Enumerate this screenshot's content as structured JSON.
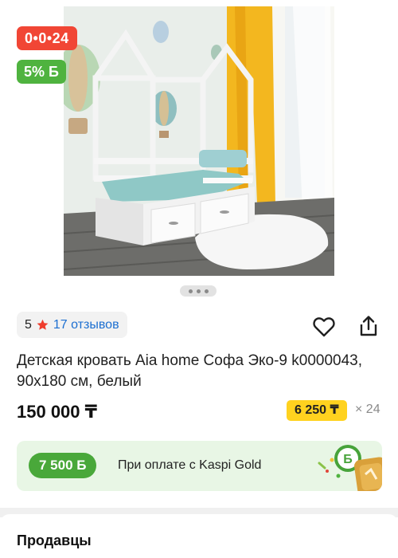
{
  "gallery": {
    "installment_badge": "0•0•24",
    "bonus_badge": "5% Б",
    "pager_count": 3
  },
  "rating": {
    "score": "5",
    "reviews": "17 отзывов"
  },
  "product": {
    "title": "Детская кровать Aia home Софа Эко-9 k0000043, 90х180 см, белый",
    "price": "150 000 ₸",
    "monthly": "6 250 ₸",
    "months": "× 24"
  },
  "kaspi_gold": {
    "bonus": "7 500 Б",
    "text": "При оплате с Kaspi Gold"
  },
  "sellers": {
    "title": "Продавцы"
  },
  "colors": {
    "installment_red": "#f14635",
    "bonus_green": "#4fb33f",
    "monthly_yellow": "#ffd21f",
    "link_blue": "#1c6fd1",
    "gold_banner_bg": "#e8f6e5"
  }
}
